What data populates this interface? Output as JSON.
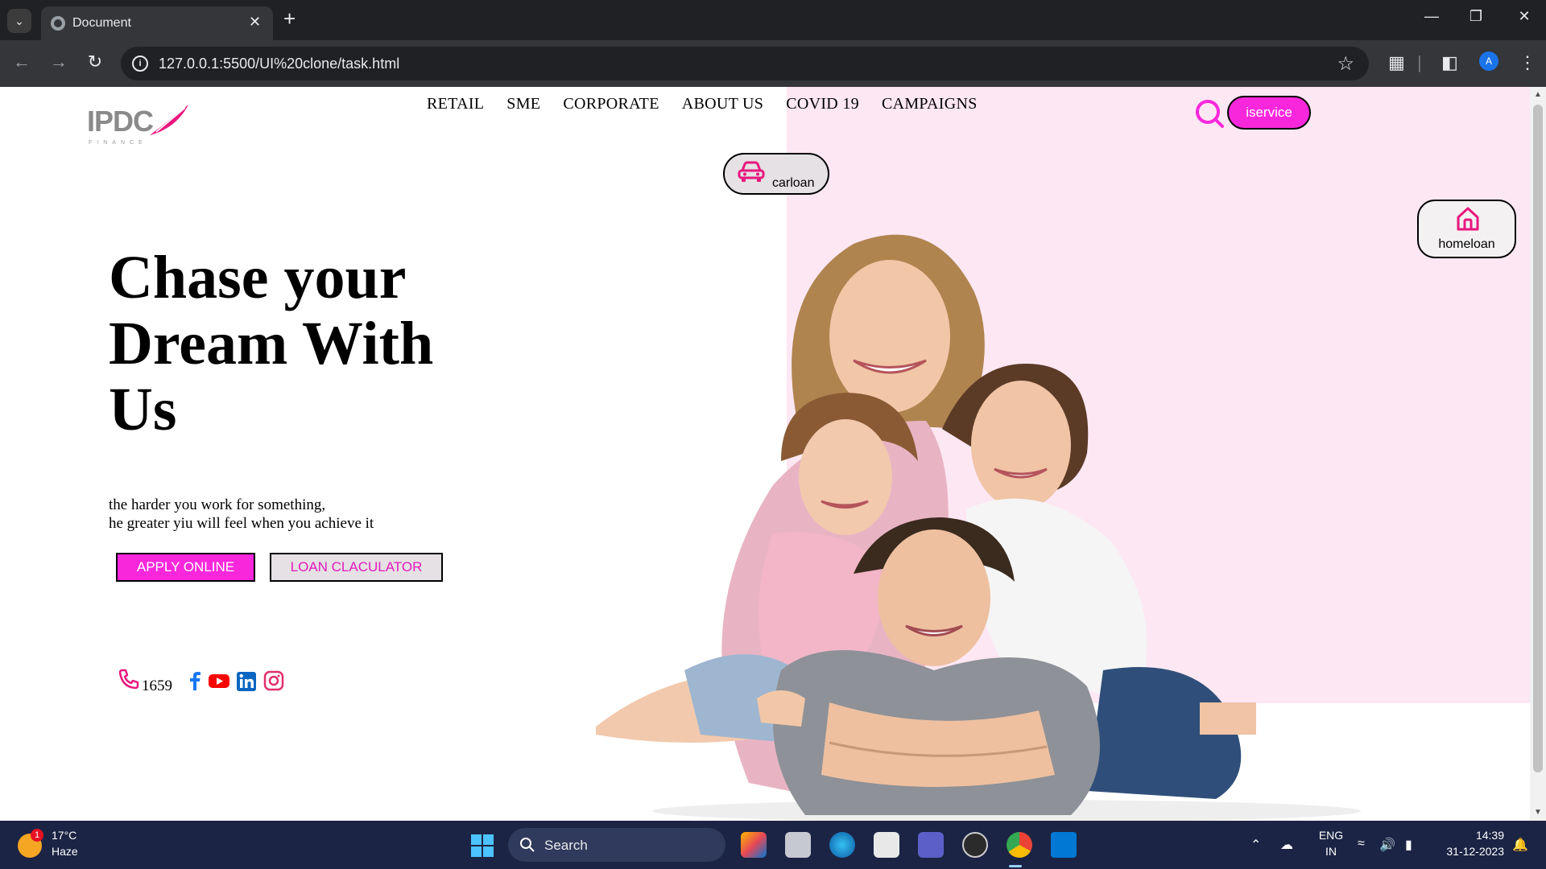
{
  "browser": {
    "tab_title": "Document",
    "url": "127.0.0.1:5500/UI%20clone/task.html",
    "profile_initial": "A"
  },
  "site": {
    "logo_text": "IPDC",
    "logo_sub": "FINANCE",
    "nav": [
      "RETAIL",
      "SME",
      "CORPORATE",
      "ABOUT US",
      "COVID 19",
      "CAMPAIGNS"
    ],
    "iservice_label": "iservice",
    "carloan_label": "carloan",
    "homeloan_label": "homeloan",
    "hero_title": "Chase your Dream With Us",
    "hero_line1": "the harder you work for something,",
    "hero_line2": "he greater yiu will feel when you achieve it",
    "apply_label": "APPLY ONLINE",
    "calc_label": "LOAN CLACULATOR",
    "phone_number": "1659",
    "accent_color": "#f927dc",
    "panel_color": "#fde7f3"
  },
  "taskbar": {
    "weather_temp": "17°C",
    "weather_desc": "Haze",
    "weather_badge": "1",
    "search_label": "Search",
    "lang_line1": "ENG",
    "lang_line2": "IN",
    "time": "14:39",
    "date": "31-12-2023"
  }
}
